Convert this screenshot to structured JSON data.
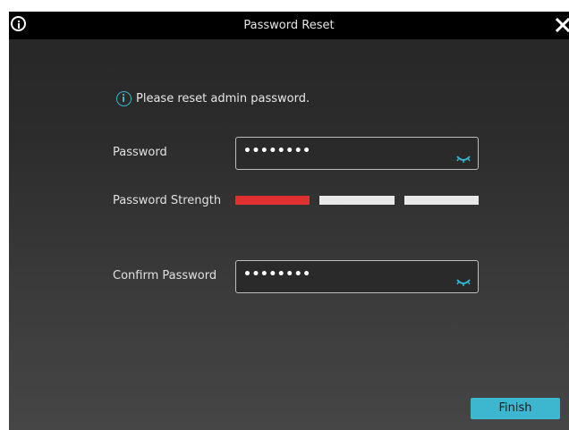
{
  "dialog": {
    "title": "Password Reset",
    "info_icon": "info-circle-icon",
    "close_icon": "close-x-icon"
  },
  "notice": {
    "icon": "info-circle-icon",
    "text": "Please reset admin password.",
    "icon_color": "#35b3cf"
  },
  "password": {
    "label": "Password",
    "value": "••••••••",
    "toggle_icon": "eye-closed-icon"
  },
  "strength": {
    "label": "Password Strength",
    "segments": [
      {
        "state": "active",
        "color": "#e03030"
      },
      {
        "state": "inactive",
        "color": "#e8e8e8"
      },
      {
        "state": "inactive",
        "color": "#e8e8e8"
      }
    ]
  },
  "confirm": {
    "label": "Confirm Password",
    "value": "••••••••",
    "toggle_icon": "eye-closed-icon"
  },
  "actions": {
    "finish_label": "Finish",
    "accent_color": "#3db6cf"
  }
}
